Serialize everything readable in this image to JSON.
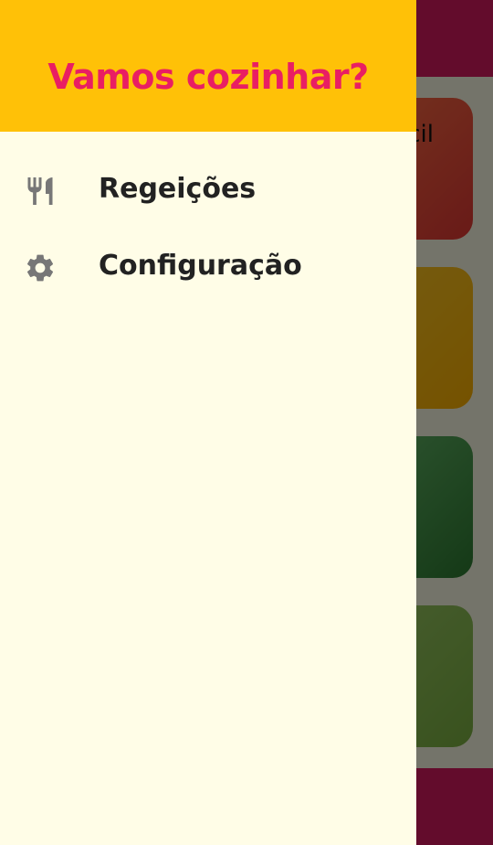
{
  "background": {
    "cards": [
      {
        "label": "cil"
      },
      {
        "label": ""
      },
      {
        "label": ""
      },
      {
        "label": ""
      }
    ]
  },
  "drawer": {
    "title": "Vamos cozinhar?",
    "items": [
      {
        "label": "Regeições",
        "icon": "restaurant-icon"
      },
      {
        "label": "Configuração",
        "icon": "settings-icon"
      }
    ]
  },
  "colors": {
    "primary": "#d81b60",
    "accent": "#ffc107",
    "title": "#e91e63",
    "drawer_bg": "#fffde7",
    "icon": "#777777"
  }
}
